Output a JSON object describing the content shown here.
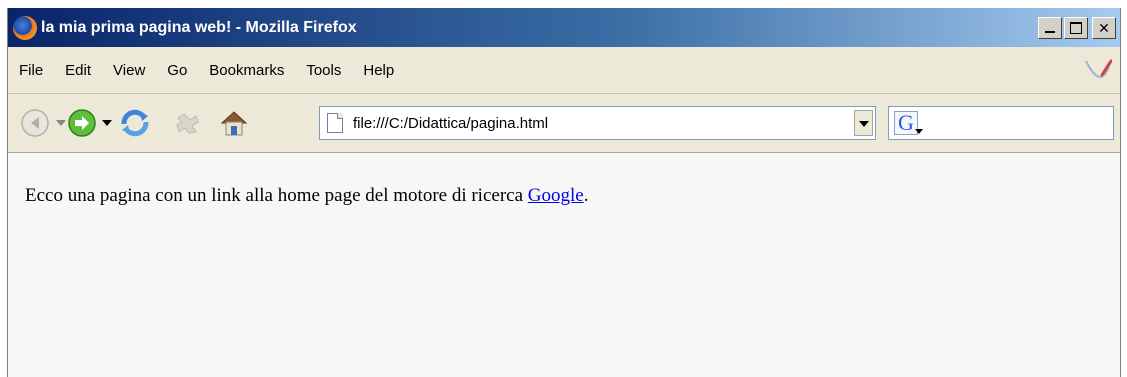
{
  "window": {
    "title": "la mia prima pagina web! - Mozilla Firefox"
  },
  "menu": {
    "items": [
      "File",
      "Edit",
      "View",
      "Go",
      "Bookmarks",
      "Tools",
      "Help"
    ]
  },
  "toolbar": {
    "icons": [
      "back-icon",
      "forward-icon",
      "reload-icon",
      "stop-icon",
      "home-icon"
    ]
  },
  "address": {
    "url": "file:///C:/Didattica/pagina.html"
  },
  "search": {
    "engine_letter": "G",
    "value": ""
  },
  "content": {
    "text_before": "Ecco una pagina con un link alla home page del motore di ricerca ",
    "link_text": "Google",
    "text_after": "."
  },
  "colors": {
    "titlebar_start": "#0a246a",
    "titlebar_end": "#a6caf0",
    "link": "#0000ee"
  }
}
